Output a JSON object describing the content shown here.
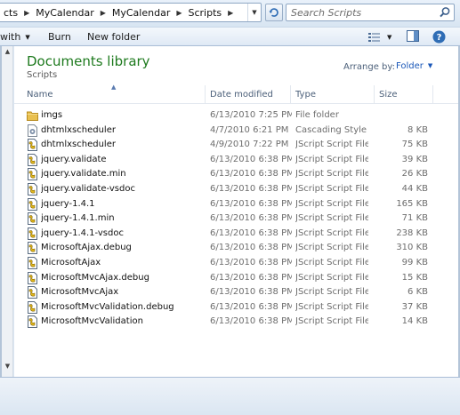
{
  "address": {
    "crumbs": [
      "cts",
      "MyCalendar",
      "MyCalendar",
      "Scripts"
    ],
    "search_placeholder": "Search Scripts"
  },
  "toolbar": {
    "open_with_label": "with",
    "burn_label": "Burn",
    "new_folder_label": "New folder"
  },
  "library": {
    "title": "Documents library",
    "subtitle": "Scripts",
    "arrange_label": "Arrange by:",
    "arrange_value": "Folder"
  },
  "columns": {
    "name": "Name",
    "date": "Date modified",
    "type": "Type",
    "size": "Size"
  },
  "files": [
    {
      "name": "imgs",
      "date": "6/13/2010 7:25 PM",
      "type": "File folder",
      "size": "",
      "icon": "folder-icon"
    },
    {
      "name": "dhtmlxscheduler",
      "date": "4/7/2010 6:21 PM",
      "type": "Cascading Style S...",
      "size": "8 KB",
      "icon": "css-file-icon"
    },
    {
      "name": "dhtmlxscheduler",
      "date": "4/9/2010 7:22 PM",
      "type": "JScript Script File",
      "size": "75 KB",
      "icon": "script-file-icon"
    },
    {
      "name": "jquery.validate",
      "date": "6/13/2010 6:38 PM",
      "type": "JScript Script File",
      "size": "39 KB",
      "icon": "script-file-icon"
    },
    {
      "name": "jquery.validate.min",
      "date": "6/13/2010 6:38 PM",
      "type": "JScript Script File",
      "size": "26 KB",
      "icon": "script-file-icon"
    },
    {
      "name": "jquery.validate-vsdoc",
      "date": "6/13/2010 6:38 PM",
      "type": "JScript Script File",
      "size": "44 KB",
      "icon": "script-file-icon"
    },
    {
      "name": "jquery-1.4.1",
      "date": "6/13/2010 6:38 PM",
      "type": "JScript Script File",
      "size": "165 KB",
      "icon": "script-file-icon"
    },
    {
      "name": "jquery-1.4.1.min",
      "date": "6/13/2010 6:38 PM",
      "type": "JScript Script File",
      "size": "71 KB",
      "icon": "script-file-icon"
    },
    {
      "name": "jquery-1.4.1-vsdoc",
      "date": "6/13/2010 6:38 PM",
      "type": "JScript Script File",
      "size": "238 KB",
      "icon": "script-file-icon"
    },
    {
      "name": "MicrosoftAjax.debug",
      "date": "6/13/2010 6:38 PM",
      "type": "JScript Script File",
      "size": "310 KB",
      "icon": "script-file-icon"
    },
    {
      "name": "MicrosoftAjax",
      "date": "6/13/2010 6:38 PM",
      "type": "JScript Script File",
      "size": "99 KB",
      "icon": "script-file-icon"
    },
    {
      "name": "MicrosoftMvcAjax.debug",
      "date": "6/13/2010 6:38 PM",
      "type": "JScript Script File",
      "size": "15 KB",
      "icon": "script-file-icon"
    },
    {
      "name": "MicrosoftMvcAjax",
      "date": "6/13/2010 6:38 PM",
      "type": "JScript Script File",
      "size": "6 KB",
      "icon": "script-file-icon"
    },
    {
      "name": "MicrosoftMvcValidation.debug",
      "date": "6/13/2010 6:38 PM",
      "type": "JScript Script File",
      "size": "37 KB",
      "icon": "script-file-icon"
    },
    {
      "name": "MicrosoftMvcValidation",
      "date": "6/13/2010 6:38 PM",
      "type": "JScript Script File",
      "size": "14 KB",
      "icon": "script-file-icon"
    }
  ],
  "icons": {
    "refresh": "refresh-icon",
    "search": "search-icon",
    "views": "views-icon",
    "preview_pane": "preview-pane-icon",
    "help": "help-icon"
  },
  "colors": {
    "library_title": "#1e7a1e",
    "link_blue": "#1a57b8",
    "header_text": "#4c607a"
  }
}
